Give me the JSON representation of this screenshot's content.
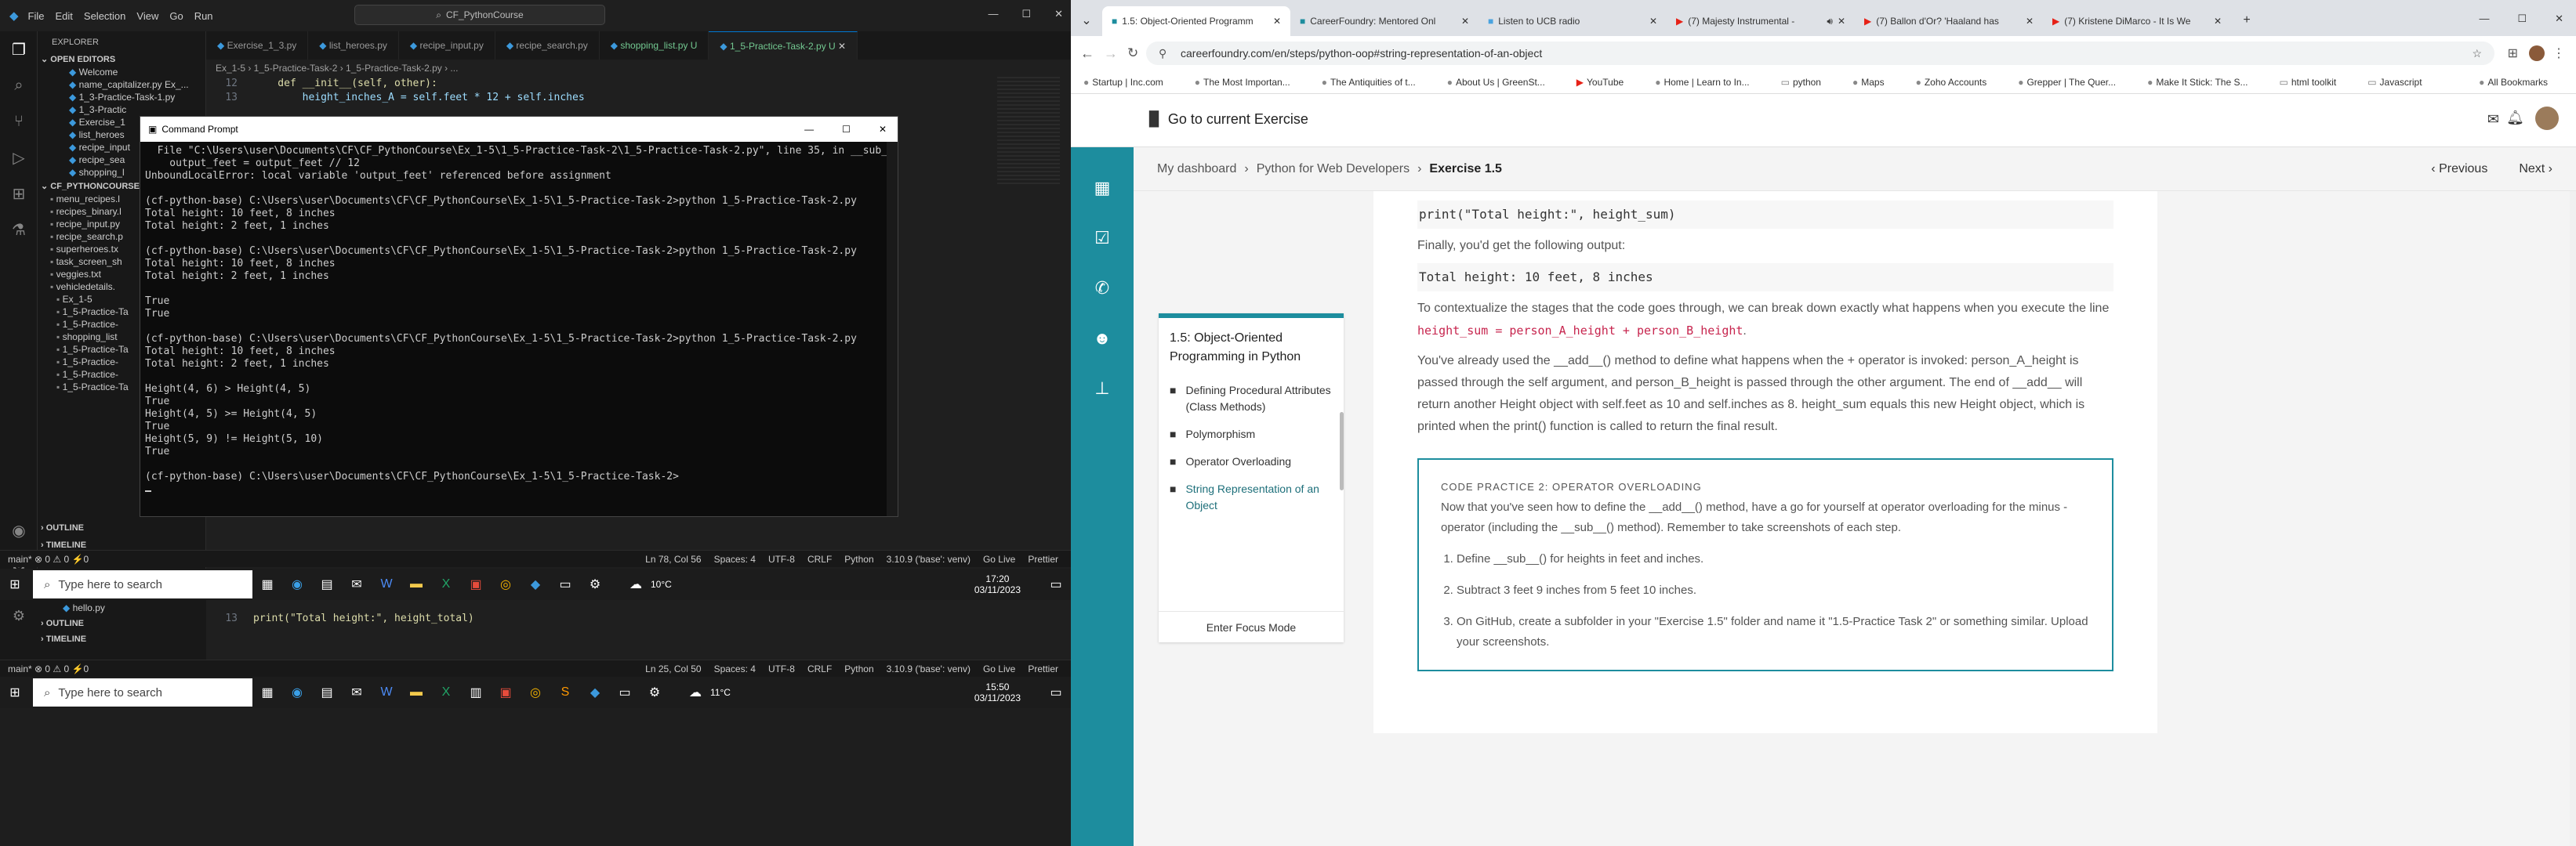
{
  "vscode_top": {
    "menu": [
      "File",
      "Edit",
      "Selection",
      "View",
      "Go",
      "Run"
    ],
    "search": "CF_PythonCourse",
    "explorer_title": "EXPLORER",
    "open_editors_title": "OPEN EDITORS",
    "open_editors": [
      "Welcome",
      "name_capitalizer.py  Ex_...",
      "1_3-Practice-Task-1.py",
      "1_3-Practic",
      "Exercise_1",
      "list_heroes",
      "recipe_input",
      "recipe_sea",
      "shopping_l"
    ],
    "project_title": "CF_PYTHONCOURSE",
    "project_files": [
      "menu_recipes.l",
      "recipes_binary.l",
      "recipe_input.py",
      "recipe_search.p",
      "superheroes.tx",
      "task_screen_sh",
      "veggies.txt",
      "vehicledetails.",
      "Ex_1-5",
      "1_5-Practice-Ta",
      "1_5-Practice-",
      "shopping_list",
      "1_5-Practice-Ta",
      "1_5-Practice-",
      "1_5-Practice-",
      "1_5-Practice-Ta"
    ],
    "outline": "OUTLINE",
    "timeline": "TIMELINE",
    "tabs": [
      "Exercise_1_3.py",
      "list_heroes.py",
      "recipe_input.py",
      "recipe_search.py",
      "shopping_list.py  U",
      "1_5-Practice-Task-2.py  U"
    ],
    "breadcrumb": "Ex_1-5  ›  1_5-Practice-Task-2  ›  1_5-Practice-Task-2.py  ›  ...",
    "code_lines": [
      {
        "num": "12",
        "text": "    def __init__(self, other):"
      },
      {
        "num": "13",
        "text": "        height_inches_A = self.feet * 12 + self.inches"
      }
    ],
    "status_left": "main*   ⊗ 0 ⚠ 0   ⚡0",
    "status_right": [
      "Ln 78, Col 56",
      "Spaces: 4",
      "UTF-8",
      "CRLF",
      "Python",
      "3.10.9 ('base': venv)",
      "Go Live",
      "Prettier"
    ]
  },
  "cmd": {
    "title": "Command Prompt",
    "lines": [
      "  File \"C:\\Users\\user\\Documents\\CF\\CF_PythonCourse\\Ex_1-5\\1_5-Practice-Task-2\\1_5-Practice-Task-2.py\", line 35, in __sub__",
      "    output_feet = output_feet // 12",
      "UnboundLocalError: local variable 'output_feet' referenced before assignment",
      "",
      "(cf-python-base) C:\\Users\\user\\Documents\\CF\\CF_PythonCourse\\Ex_1-5\\1_5-Practice-Task-2>python 1_5-Practice-Task-2.py",
      "Total height: 10 feet, 8 inches",
      "Total height: 2 feet, 1 inches",
      "",
      "(cf-python-base) C:\\Users\\user\\Documents\\CF\\CF_PythonCourse\\Ex_1-5\\1_5-Practice-Task-2>python 1_5-Practice-Task-2.py",
      "Total height: 10 feet, 8 inches",
      "Total height: 2 feet, 1 inches",
      "",
      "True",
      "True",
      "",
      "(cf-python-base) C:\\Users\\user\\Documents\\CF\\CF_PythonCourse\\Ex_1-5\\1_5-Practice-Task-2>python 1_5-Practice-Task-2.py",
      "Total height: 10 feet, 8 inches",
      "Total height: 2 feet, 1 inches",
      "",
      "Height(4, 6) > Height(4, 5)",
      "True",
      "Height(4, 5) >= Height(4, 5)",
      "True",
      "Height(5, 9) != Height(5, 10)",
      "True",
      "",
      "(cf-python-base) C:\\Users\\user\\Documents\\CF\\CF_PythonCourse\\Ex_1-5\\1_5-Practice-Task-2>"
    ]
  },
  "taskbar_top": {
    "search": "Type here to search",
    "weather": "10°C",
    "time": "17:20",
    "date": "03/11/2023"
  },
  "vscode_bottom": {
    "file": "hello.py",
    "outline": "OUTLINE",
    "timeline": "TIMELINE",
    "code_num": "13",
    "code_text": "print(\"Total height:\", height_total)",
    "status_left": "main*   ⊗ 0 ⚠ 0   ⚡0",
    "status_right": [
      "Ln 25, Col 50",
      "Spaces: 4",
      "UTF-8",
      "CRLF",
      "Python",
      "3.10.9 ('base': venv)",
      "Go Live",
      "Prettier"
    ]
  },
  "taskbar_bottom": {
    "search": "Type here to search",
    "weather": "11°C",
    "time": "15:50",
    "date": "03/11/2023"
  },
  "browser": {
    "tabs": [
      "1.5: Object-Oriented Programm",
      "CareerFoundry: Mentored Onl",
      "Listen to UCB radio",
      "(7) Majesty Instrumental -",
      "(7) Ballon d'Or? 'Haaland has",
      "(7) Kristene DiMarco - It Is We"
    ],
    "url": "careerfoundry.com/en/steps/python-oop#string-representation-of-an-object",
    "bookmarks": [
      "Startup | Inc.com",
      "The Most Importan...",
      "The Antiquities of t...",
      "About Us | GreenSt...",
      "YouTube",
      "Home | Learn to In...",
      "python",
      "Maps",
      "Zoho Accounts",
      "Grepper | The Quer...",
      "Make It Stick: The S...",
      "html toolkit",
      "Javascript",
      "All Bookmarks"
    ]
  },
  "cf": {
    "logo": "CF",
    "go_to_exercise": "Go to current Exercise",
    "crumbs": [
      "My dashboard",
      "Python for Web Developers",
      "Exercise 1.5"
    ],
    "prev": "Previous",
    "next": "Next",
    "toc_title": "1.5: Object-Oriented Programming in Python",
    "toc_items": [
      "Defining Procedural Attributes (Class Methods)",
      "Polymorphism",
      "Operator Overloading",
      "String Representation of an Object"
    ],
    "focus_mode": "Enter Focus Mode",
    "code_print": "print(\"Total height:\", height_sum)",
    "finally": "Finally, you'd get the following output:",
    "output": "Total height: 10 feet, 8 inches",
    "para1_a": "To contextualize the stages that the code goes through, we can break down exactly what happens when you execute the line",
    "para1_code": "height_sum = person_A_height + person_B_height",
    "para2": "You've already used the __add__() method to define what happens when the + operator is invoked: person_A_height is passed through the self argument, and person_B_height is passed through the other argument. The end of __add__ will return another Height object with self.feet as 10 and self.inches as 8. height_sum equals this new Height object, which is printed when the print() function is called to return the final result.",
    "practice_label": "CODE PRACTICE 2: OPERATOR OVERLOADING",
    "practice_intro": "Now that you've seen how to define the __add__() method, have a go for yourself at operator overloading for the minus - operator (including the __sub__() method). Remember to take screenshots of each step.",
    "steps": [
      "Define __sub__() for heights in feet and inches.",
      "Subtract 3 feet 9 inches from 5 feet 10 inches.",
      "On GitHub, create a subfolder in your \"Exercise 1.5\" folder and name it \"1.5-Practice Task 2\" or something similar. Upload your screenshots."
    ]
  }
}
